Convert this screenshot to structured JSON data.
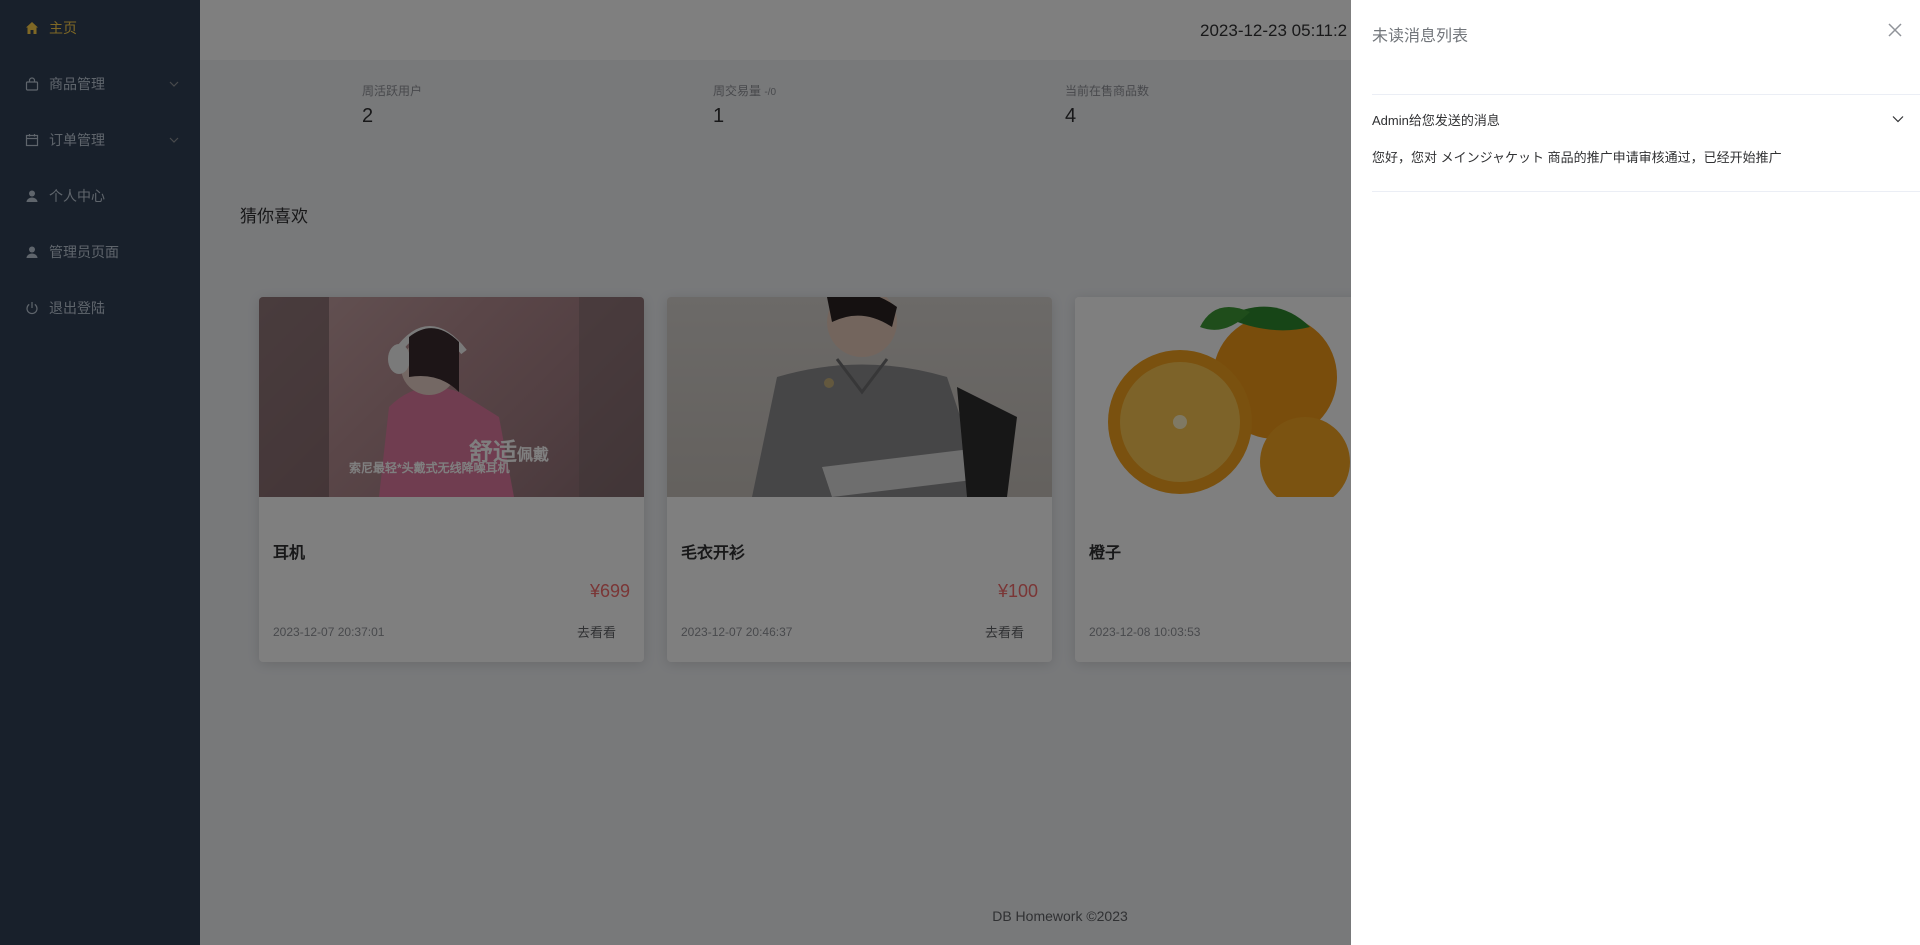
{
  "sidebar": {
    "items": [
      {
        "label": "主页",
        "icon": "home-icon",
        "active": true
      },
      {
        "label": "商品管理",
        "icon": "bag-icon",
        "expandable": true
      },
      {
        "label": "订单管理",
        "icon": "calendar-icon",
        "expandable": true
      },
      {
        "label": "个人中心",
        "icon": "user-icon"
      },
      {
        "label": "管理员页面",
        "icon": "user-icon"
      },
      {
        "label": "退出登陆",
        "icon": "power-icon"
      }
    ],
    "bg_color": "#304156",
    "active_color": "#ffd04b"
  },
  "header": {
    "datetime": "2023-12-23 05:11:2"
  },
  "stats": [
    {
      "label": "周活跃用户",
      "value": "2"
    },
    {
      "label": "周交易量",
      "label_suffix": "-/0",
      "value": "1"
    },
    {
      "label": "当前在售商品数",
      "value": "4"
    }
  ],
  "recommend": {
    "title": "猜你喜欢",
    "cards": [
      {
        "name": "耳机",
        "price": "¥699",
        "date": "2023-12-07 20:37:01",
        "action": "去看看",
        "image_text_main": "舒适",
        "image_text_sub": "佩戴",
        "image_caption": "索尼最轻*头戴式无线降噪耳机"
      },
      {
        "name": "毛衣开衫",
        "price": "¥100",
        "date": "2023-12-07 20:46:37",
        "action": "去看看"
      },
      {
        "name": "橙子",
        "date": "2023-12-08 10:03:53"
      }
    ]
  },
  "footer": {
    "text": "DB Homework ©2023"
  },
  "drawer": {
    "title": "未读消息列表",
    "message": {
      "header": "Admin给您发送的消息",
      "body": "您好，您对 メインジャケット 商品的推广申请审核通过，已经开始推广"
    }
  },
  "colors": {
    "price": "#f56c6c",
    "overlay": "rgba(0,0,0,0.5)"
  }
}
